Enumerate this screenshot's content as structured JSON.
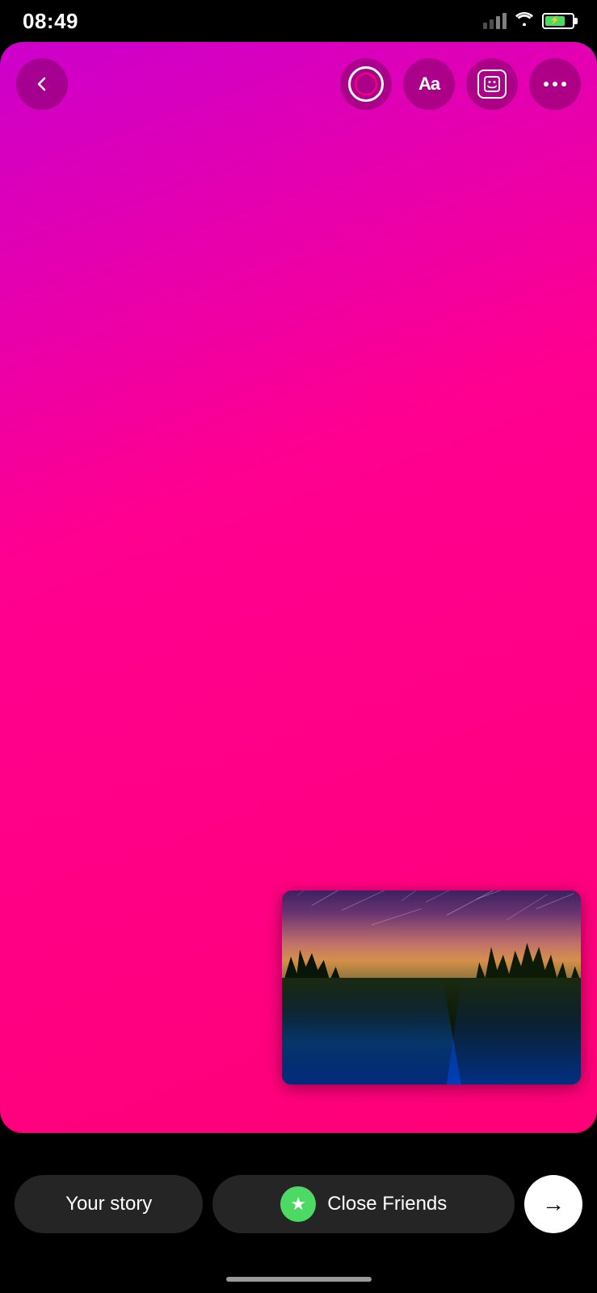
{
  "statusBar": {
    "time": "08:49",
    "battery_level": "75"
  },
  "toolbar": {
    "back_label": "‹",
    "camera_label": "camera",
    "text_label": "Aa",
    "sticker_label": "sticker",
    "more_label": "more"
  },
  "canvas": {
    "bg_color_start": "#cc00cc",
    "bg_color_end": "#ff0077"
  },
  "bottomBar": {
    "your_story_label": "Your story",
    "close_friends_label": "Close Friends",
    "arrow_label": "→"
  }
}
